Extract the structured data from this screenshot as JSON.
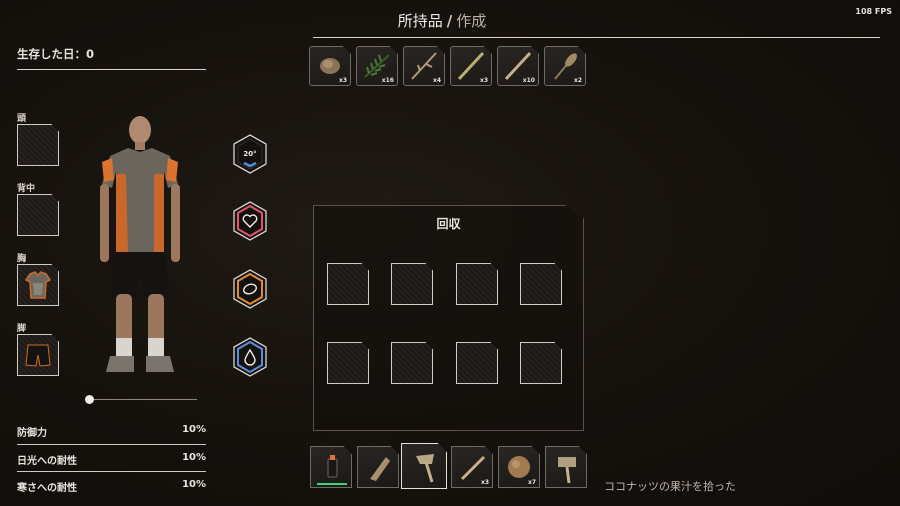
{
  "header": {
    "tab_active": "所持品",
    "separator": "/",
    "tab_inactive": "作成",
    "fps": "108 FPS"
  },
  "survival": {
    "label": "生存した日",
    "value": "0"
  },
  "equipment": [
    {
      "label": "頭",
      "filled": false
    },
    {
      "label": "背中",
      "filled": false
    },
    {
      "label": "胸",
      "filled": true
    },
    {
      "label": "脚",
      "filled": true
    }
  ],
  "stats": [
    {
      "label": "防御力",
      "value": "10%"
    },
    {
      "label": "日光への耐性",
      "value": "10%"
    },
    {
      "label": "寒さへの耐性",
      "value": "10%"
    }
  ],
  "indicators": [
    {
      "name": "temperature",
      "text": "20°",
      "color": "#4f8fd6"
    },
    {
      "name": "health",
      "icon": "heart-icon",
      "color": "#e4536a"
    },
    {
      "name": "food",
      "icon": "food-icon",
      "color": "#e08a3a"
    },
    {
      "name": "water",
      "icon": "water-drop-icon",
      "color": "#5b8fd8"
    }
  ],
  "inventory": [
    {
      "item": "coconut-husk-icon",
      "qty": "x3"
    },
    {
      "item": "leaves-icon",
      "qty": "x16"
    },
    {
      "item": "branch-icon",
      "qty": "x4"
    },
    {
      "item": "bamboo-icon",
      "qty": "x3"
    },
    {
      "item": "stick-icon",
      "qty": "x10"
    },
    {
      "item": "grass-icon",
      "qty": "x2"
    }
  ],
  "recycle": {
    "title": "回収",
    "slots": 8
  },
  "hotbar": [
    {
      "item": "flashlight-icon",
      "qty": "",
      "durability": 1.0
    },
    {
      "item": "stone-blade-icon",
      "qty": ""
    },
    {
      "item": "stone-axe-icon",
      "qty": "",
      "selected": true
    },
    {
      "item": "stick-icon",
      "qty": "x3"
    },
    {
      "item": "coconut-icon",
      "qty": "x7"
    },
    {
      "item": "stone-hammer-icon",
      "qty": ""
    }
  ],
  "notification": "ココナッツの果汁を拾った",
  "colors": {
    "accent": "#e8e4de",
    "durability_bar": "#3fd27a"
  }
}
